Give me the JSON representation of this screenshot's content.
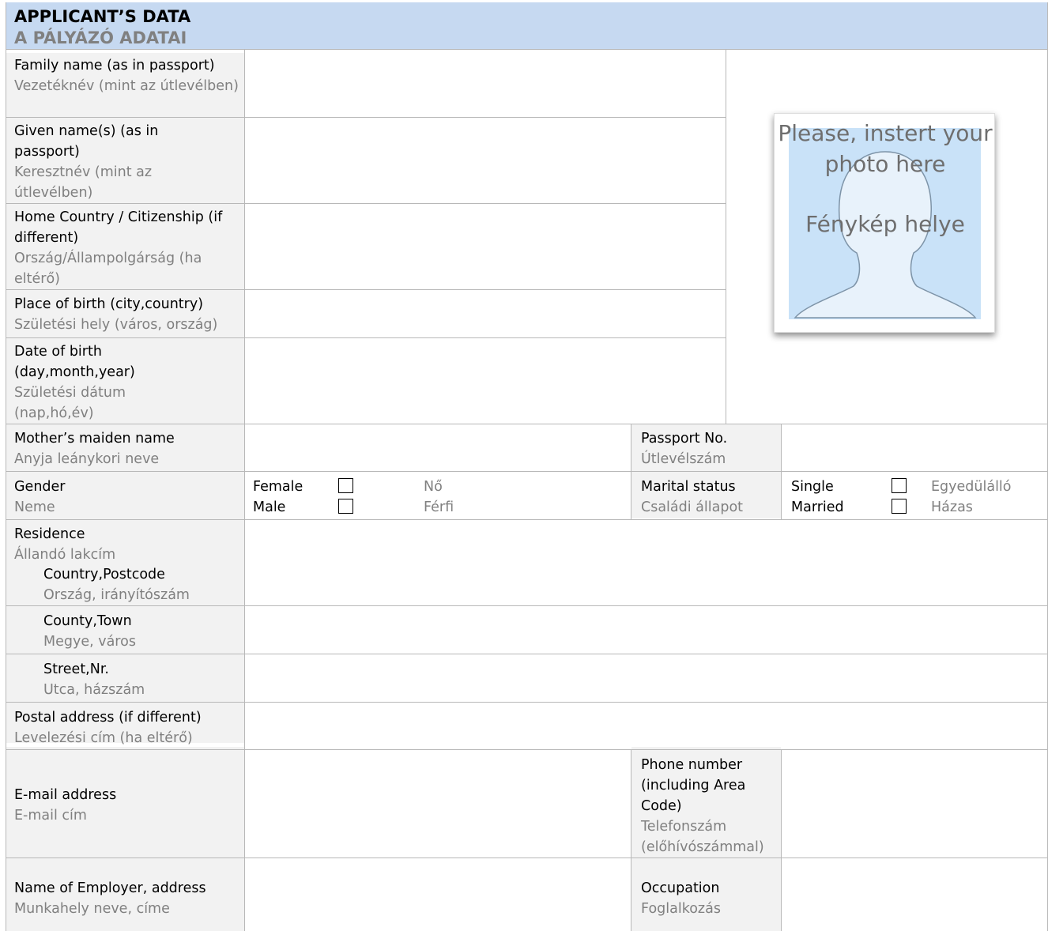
{
  "header": {
    "title_en": "APPLICANT’S DATA",
    "title_hu": "A PÁLYÁZÓ ADATAI"
  },
  "fields": {
    "family_name": {
      "en": "Family name (as in passport)",
      "hu": "Vezetéknév (mint az útlevélben)"
    },
    "given_name": {
      "en": "Given name(s) (as in passport)",
      "hu": "Keresztnév (mint az útlevélben)"
    },
    "home_country": {
      "en": "Home Country / Citizenship (if different)",
      "hu": "Ország/Állampolgárság (ha eltérő)"
    },
    "place_of_birth": {
      "en": "Place of birth (city,country)",
      "hu": "Születési hely (város, ország)"
    },
    "date_of_birth": {
      "en": "Date of birth (day,month,year)",
      "hu": "Születési dátum (nap,hó,év)"
    },
    "mother_name": {
      "en": "Mother’s maiden name",
      "hu": "Anyja leánykori neve"
    },
    "passport": {
      "en": "Passport No.",
      "hu": "Útlevélszám"
    },
    "gender": {
      "en": "Gender",
      "hu": "Neme",
      "options": [
        {
          "en": "Female",
          "hu": "Nő"
        },
        {
          "en": "Male",
          "hu": "Férfi"
        }
      ]
    },
    "marital": {
      "en": "Marital status",
      "hu": "Családi állapot",
      "options": [
        {
          "en": "Single",
          "hu": "Egyedülálló"
        },
        {
          "en": "Married",
          "hu": "Házas"
        }
      ]
    },
    "residence": {
      "en": "Residence",
      "hu": "Állandó lakcím"
    },
    "country_postcode": {
      "en": "Country,Postcode",
      "hu": "Ország, irányítószám"
    },
    "county_town": {
      "en": "County,Town",
      "hu": "Megye, város"
    },
    "street": {
      "en": "Street,Nr.",
      "hu": "Utca, házszám"
    },
    "postal": {
      "en": "Postal address (if different)",
      "hu": "Levelezési cím (ha eltérő)"
    },
    "email": {
      "en": "E-mail address",
      "hu": "E-mail cím"
    },
    "phone": {
      "en": "Phone number (including Area Code)",
      "hu": "Telefonszám (előhívószámmal)"
    },
    "employer": {
      "en": "Name of Employer, address",
      "hu": "Munkahely neve, címe"
    },
    "occupation": {
      "en": "Occupation",
      "hu": "Foglalkozás"
    }
  },
  "photo": {
    "line1": "Please, instert your",
    "line2": "photo here",
    "line3": "Fénykép helye"
  },
  "colors": {
    "header_bg": "#c6d9f1",
    "label_bg": "#f2f2f2",
    "hu_text": "#808080",
    "photo_bg": "#c9e2f8",
    "silhouette": "#e8f2fb"
  }
}
